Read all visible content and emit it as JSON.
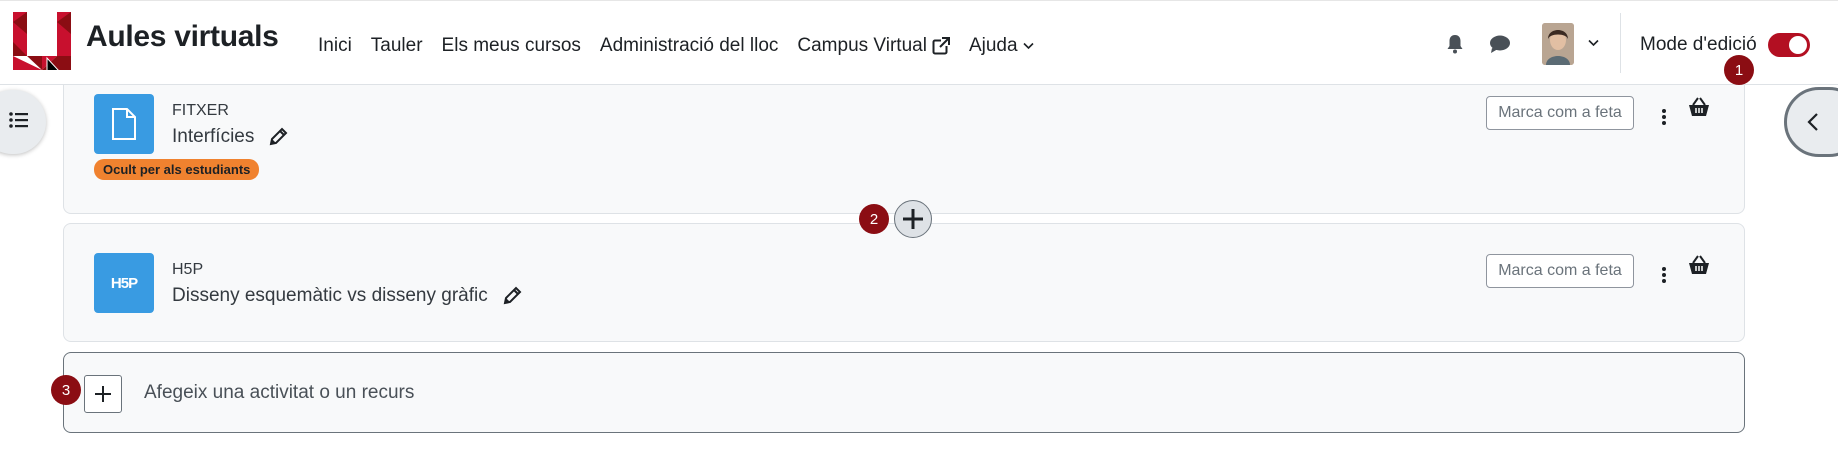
{
  "header": {
    "brand": "Aules virtuals",
    "nav": [
      {
        "label": "Inici"
      },
      {
        "label": "Tauler"
      },
      {
        "label": "Els meus cursos"
      },
      {
        "label": "Administració del lloc"
      },
      {
        "label": "Campus Virtual"
      },
      {
        "label": "Ajuda"
      }
    ],
    "edit_mode_label": "Mode d'edició",
    "edit_mode_on": true
  },
  "badges": [
    "1",
    "2",
    "3"
  ],
  "activities": [
    {
      "type": "FITXER",
      "name": "Interfícies",
      "icon": "file-icon",
      "hidden_badge": "Ocult per als estudiants",
      "mark_label": "Marca com a feta"
    },
    {
      "type": "H5P",
      "name": "Disseny esquemàtic vs disseny gràfic",
      "icon": "h5p-icon",
      "icon_text": "H5P",
      "mark_label": "Marca com a feta"
    }
  ],
  "add_activity": {
    "label": "Afegeix una activitat o un recurs"
  },
  "colors": {
    "accent": "#b30f22",
    "badge": "#8b0d13",
    "activity_icon": "#399be2",
    "hidden_badge": "#f0822f"
  }
}
